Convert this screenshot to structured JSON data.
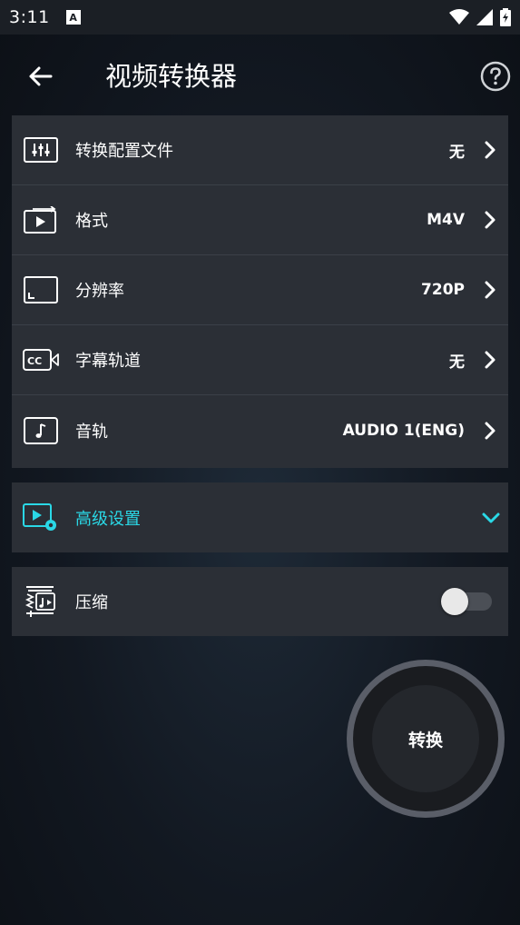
{
  "status_bar": {
    "time": "3:11",
    "notification_letter": "A"
  },
  "app_bar": {
    "title": "视频转换器",
    "back_icon": "arrow-left-icon",
    "help_icon": "help-circle-icon"
  },
  "settings": [
    {
      "label": "转换配置文件",
      "value": "无",
      "icon": "sliders-icon"
    },
    {
      "label": "格式",
      "value": "M4V",
      "icon": "video-format-icon"
    },
    {
      "label": "分辨率",
      "value": "720P",
      "icon": "resolution-icon"
    },
    {
      "label": "字幕轨道",
      "value": "无",
      "icon": "subtitle-cc-icon"
    },
    {
      "label": "音轨",
      "value": "AUDIO 1(ENG)",
      "icon": "music-note-icon"
    }
  ],
  "advanced": {
    "label": "高级设置",
    "icon": "video-settings-icon",
    "expanded": false,
    "accent_color": "#2ad8e6"
  },
  "compress": {
    "label": "压缩",
    "icon": "compress-icon",
    "enabled": false
  },
  "convert_button": {
    "label": "转换"
  }
}
